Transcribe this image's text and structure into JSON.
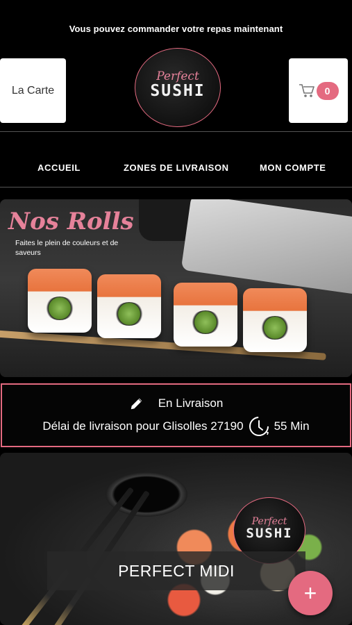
{
  "header": {
    "message": "Vous pouvez commander votre repas maintenant",
    "carte_label": "La Carte",
    "cart_count": "0",
    "logo_top": "Perfect",
    "logo_bottom": "SUSHI"
  },
  "nav": {
    "items": [
      {
        "label": "ACCUEIL"
      },
      {
        "label": "ZONES DE LIVRAISON"
      },
      {
        "label": "MON COMPTE"
      }
    ]
  },
  "hero": {
    "title": "Nos Rolls",
    "subtitle": "Faites le plein de couleurs et de saveurs"
  },
  "delivery": {
    "mode": "En Livraison",
    "text": "Délai de livraison pour Glisolles 27190",
    "time": "55 Min"
  },
  "product": {
    "label": "PERFECT MIDI",
    "logo_top": "Perfect",
    "logo_bottom": "SUSHI",
    "add_symbol": "+"
  },
  "colors": {
    "accent": "#e46a80",
    "background": "#000000"
  }
}
